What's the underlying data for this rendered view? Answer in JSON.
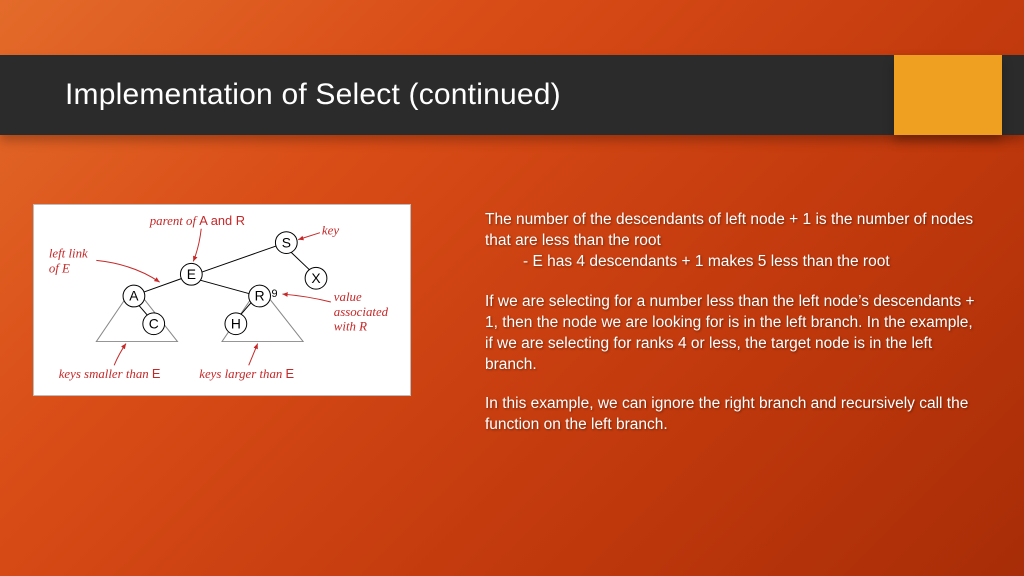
{
  "title": "Implementation of Select (continued)",
  "paragraphs": {
    "p1a": "The number of the descendants of left node + 1 is the number of nodes that are less than the root",
    "p1b": "- E has 4 descendants + 1 makes 5 less than the root",
    "p2": "If we are selecting for a number less than the left node’s descendants + 1, then the node we are looking for is in the left branch.  In the example, if we are selecting for ranks 4 or less, the target node is in the left branch.",
    "p3": "In this example, we can ignore the right branch and recursively call the function on the left branch."
  },
  "diagram": {
    "nodes": {
      "S": "S",
      "E": "E",
      "X": "X",
      "A": "A",
      "R": "R",
      "C": "C",
      "H": "H"
    },
    "value_nine": "9",
    "labels": {
      "parent": "parent of",
      "parent_suffix": "A and R",
      "key": "key",
      "left_link_1": "left link",
      "left_link_2": "of E",
      "value_1": "value",
      "value_2": "associated",
      "value_3": "with R",
      "smaller": "keys smaller than E",
      "larger": "keys larger than E"
    }
  }
}
